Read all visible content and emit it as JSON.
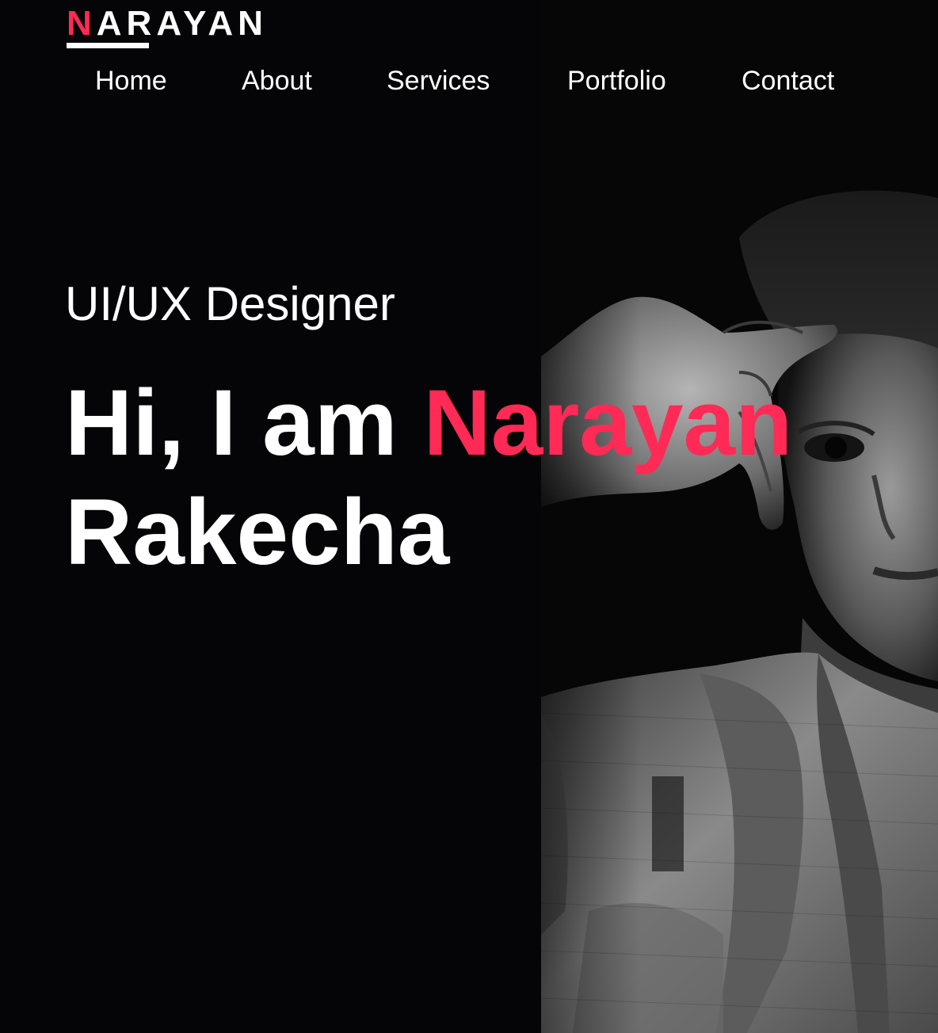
{
  "logo": {
    "first_letter": "N",
    "rest": "ARAYAN"
  },
  "nav": {
    "items": [
      {
        "label": "Home"
      },
      {
        "label": "About"
      },
      {
        "label": "Services"
      },
      {
        "label": "Portfolio"
      },
      {
        "label": "Contact"
      }
    ]
  },
  "hero": {
    "role": "UI/UX Designer",
    "greeting": "Hi, I am",
    "first_name": "Narayan",
    "last_name": "Rakecha"
  },
  "colors": {
    "background": "#050507",
    "accent": "#ff2a55",
    "text": "#ffffff"
  },
  "image": {
    "icon": "portrait-photo"
  }
}
